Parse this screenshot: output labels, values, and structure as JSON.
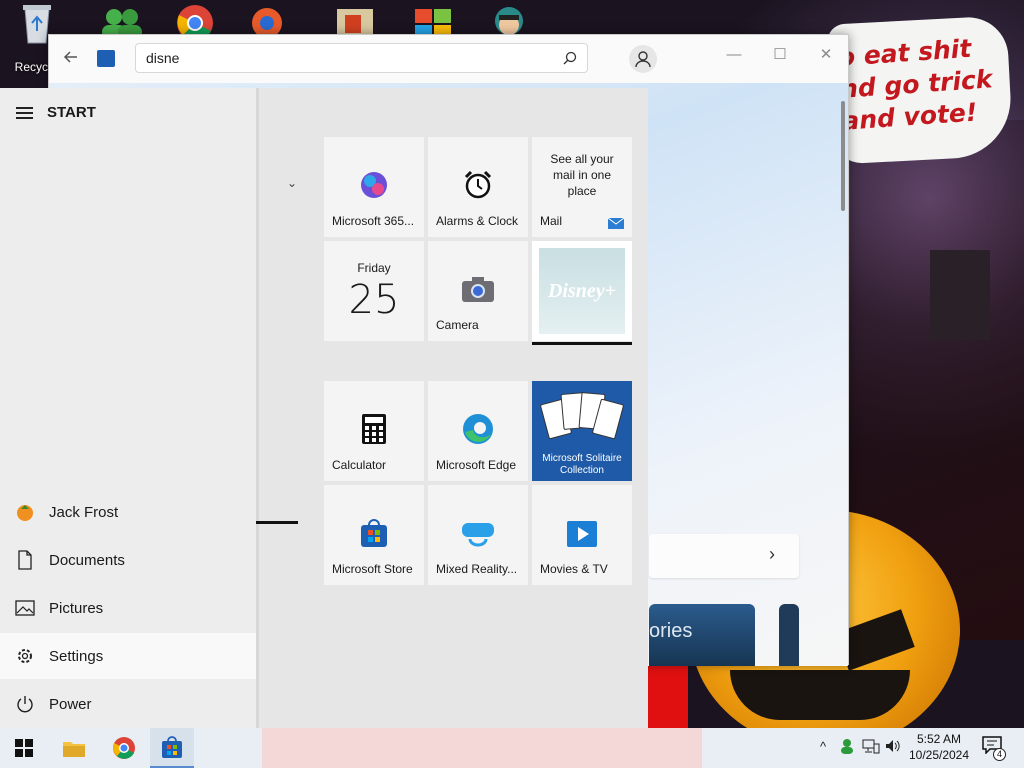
{
  "desktop": {
    "recycle_label": "Recycle",
    "wallpaper_text": "o eat shit\nnd go trick\nand vote!"
  },
  "browser": {
    "search_value": "disne",
    "promo_text": "ories",
    "controls": {
      "minimize": "—",
      "maximize": "☐",
      "close": "✕"
    }
  },
  "start": {
    "title": "START",
    "left_items": [
      {
        "label": "Jack Frost",
        "icon": "user-avatar-icon"
      },
      {
        "label": "Documents",
        "icon": "document-icon"
      },
      {
        "label": "Pictures",
        "icon": "pictures-icon"
      },
      {
        "label": "Settings",
        "icon": "gear-icon"
      },
      {
        "label": "Power",
        "icon": "power-icon"
      }
    ],
    "tiles": {
      "microsoft365": "Microsoft 365...",
      "alarms": "Alarms & Clock",
      "mail_label": "Mail",
      "mail_text": "See all your mail in one place",
      "calendar_day": "Friday",
      "calendar_date": "25",
      "camera": "Camera",
      "disney": "Disney+",
      "calculator": "Calculator",
      "edge": "Microsoft Edge",
      "solitaire": "Microsoft Solitaire Collection",
      "store": "Microsoft Store",
      "mixed_reality": "Mixed Reality...",
      "movies": "Movies & TV"
    }
  },
  "taskbar": {
    "time": "5:52 AM",
    "date": "10/25/2024",
    "notification_count": "4"
  },
  "colors": {
    "accent": "#1e5fb4",
    "solitaire_bg": "#1f5aa8",
    "start_left_bg": "#ededed",
    "start_tiles_bg": "#e6e6e6"
  }
}
